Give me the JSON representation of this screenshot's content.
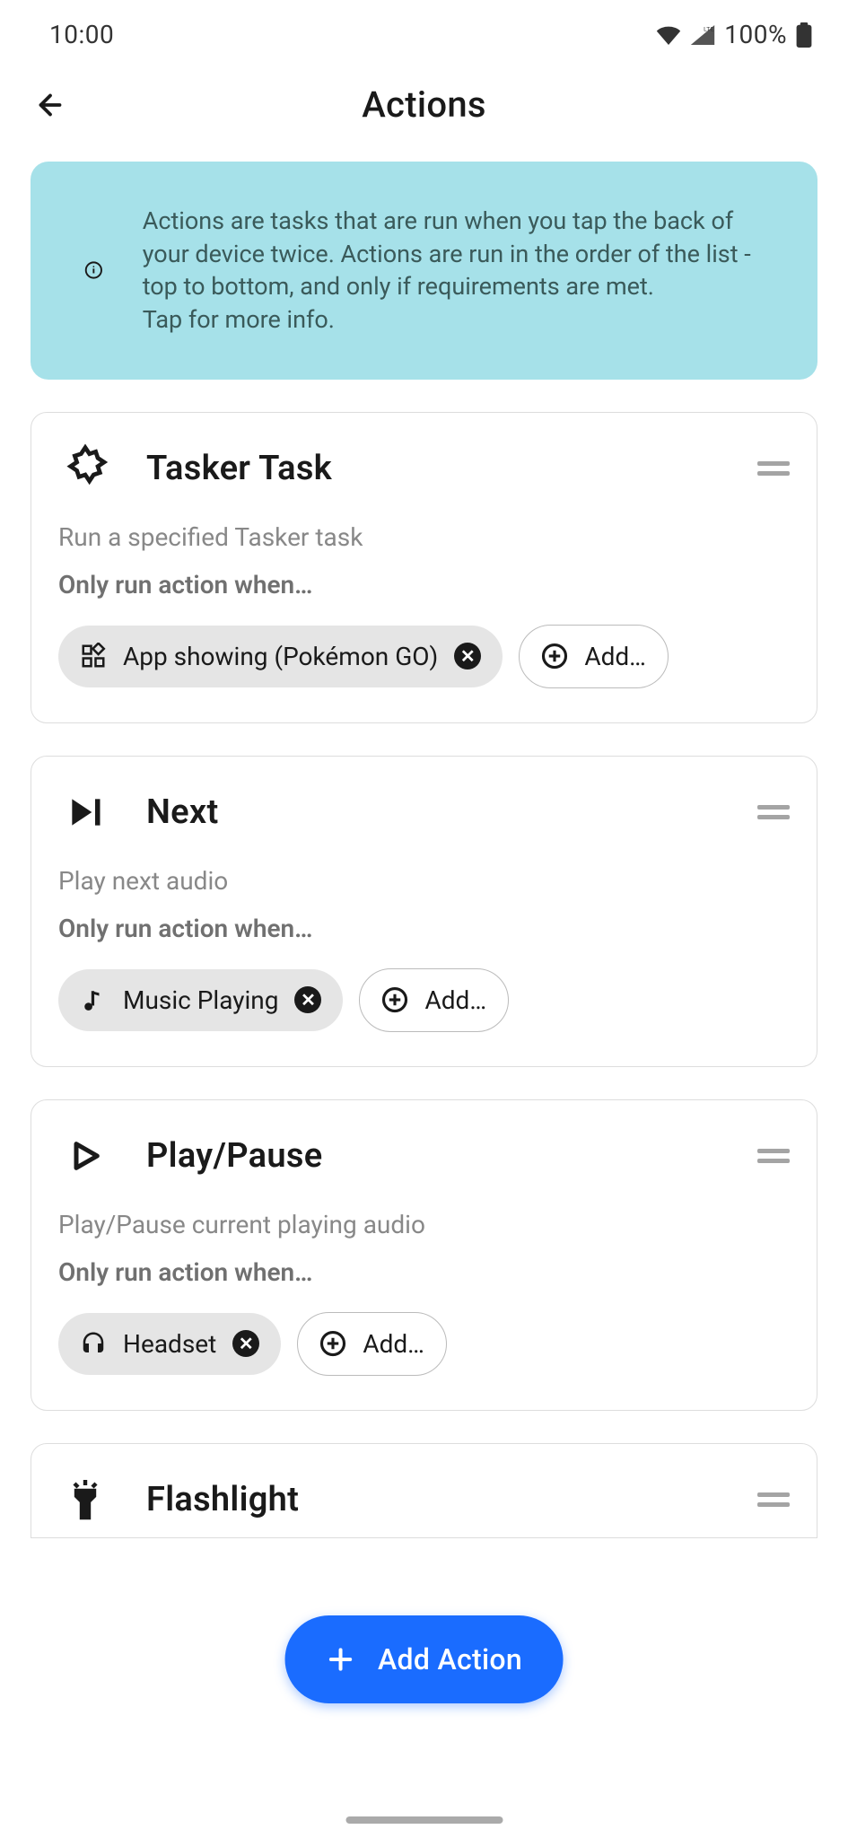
{
  "status": {
    "time": "10:00",
    "battery": "100%"
  },
  "header": {
    "title": "Actions"
  },
  "info": {
    "text": "Actions are tasks that are run when you tap the back of your device twice. Actions are run in the order of the list - top to bottom, and only if requirements are met.\nTap for more info."
  },
  "actions": [
    {
      "title": "Tasker Task",
      "description": "Run a specified Tasker task",
      "condition_label": "Only run action when…",
      "chips": [
        {
          "label": "App showing (Pokémon GO)"
        }
      ],
      "add_label": "Add…"
    },
    {
      "title": "Next",
      "description": "Play next audio",
      "condition_label": "Only run action when…",
      "chips": [
        {
          "label": "Music Playing"
        }
      ],
      "add_label": "Add…"
    },
    {
      "title": "Play/Pause",
      "description": "Play/Pause current playing audio",
      "condition_label": "Only run action when…",
      "chips": [
        {
          "label": "Headset"
        }
      ],
      "add_label": "Add…"
    },
    {
      "title": "Flashlight",
      "description": "",
      "condition_label": "",
      "chips": [],
      "add_label": ""
    }
  ],
  "fab": {
    "label": "Add Action"
  }
}
